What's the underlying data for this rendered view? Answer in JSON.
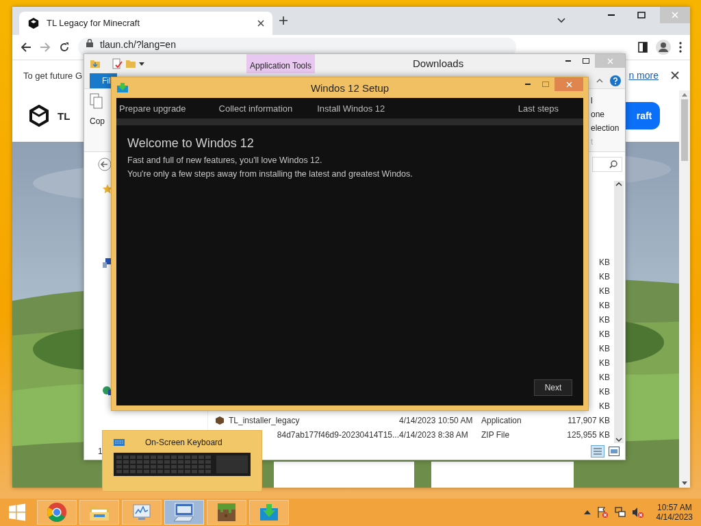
{
  "browser": {
    "tab_title": "TL Legacy for Minecraft",
    "address": "tlaun.ch/?lang=en",
    "infobar_text": "To get future G",
    "infobar_link": "n more",
    "site_logo": "TL",
    "site_button": "raft"
  },
  "explorer": {
    "title": "Downloads",
    "context_tab": "Application Tools",
    "file_tab": "Fil",
    "copy_label": "Cop",
    "ribbon_options": [
      {
        "label": "l",
        "disabled": false
      },
      {
        "label": "one",
        "disabled": false
      },
      {
        "label": "election",
        "disabled": false
      },
      {
        "label": "t",
        "disabled": true
      }
    ],
    "rows": [
      {
        "kind": "size",
        "size": "KB"
      },
      {
        "kind": "size",
        "size": "KB"
      },
      {
        "kind": "size",
        "size": "KB"
      },
      {
        "kind": "size",
        "size": "KB"
      },
      {
        "kind": "size",
        "size": "KB"
      },
      {
        "kind": "size",
        "size": "KB"
      },
      {
        "kind": "size",
        "size": "KB"
      },
      {
        "kind": "size",
        "size": "KB"
      },
      {
        "kind": "size",
        "size": "KB"
      },
      {
        "kind": "size",
        "size": "KB"
      },
      {
        "kind": "size",
        "size": "KB"
      },
      {
        "kind": "file",
        "name": "TL_installer_legacy",
        "date": "4/14/2023 10:50 AM",
        "type": "Application",
        "size": "117,907 KB"
      },
      {
        "kind": "covered",
        "name": "84d7ab177f46d9-20230414T15...",
        "date": "4/14/2023 8:38 AM",
        "type": "ZIP File",
        "size": "125,955 KB"
      }
    ],
    "item_count": "1"
  },
  "setup": {
    "title": "Windos 12 Setup",
    "steps": [
      "Prepare upgrade",
      "Collect information",
      "Install Windos 12",
      "Last steps"
    ],
    "heading": "Welcome to Windos 12",
    "lines": [
      "Fast and full of new features, you'll love Windos 12.",
      "You're only a few steps away from installing the latest and greatest Windos."
    ],
    "next_button": "Next"
  },
  "taskbar": {
    "preview_title": "On-Screen Keyboard",
    "apps": [
      {
        "kind": "chrome",
        "selected": false
      },
      {
        "kind": "explorer",
        "selected": false
      },
      {
        "kind": "monitor",
        "selected": false
      },
      {
        "kind": "keyboard",
        "selected": true
      },
      {
        "kind": "grass",
        "selected": false
      },
      {
        "kind": "installer",
        "selected": false
      }
    ],
    "time": "10:57 AM",
    "date": "4/14/2023"
  }
}
